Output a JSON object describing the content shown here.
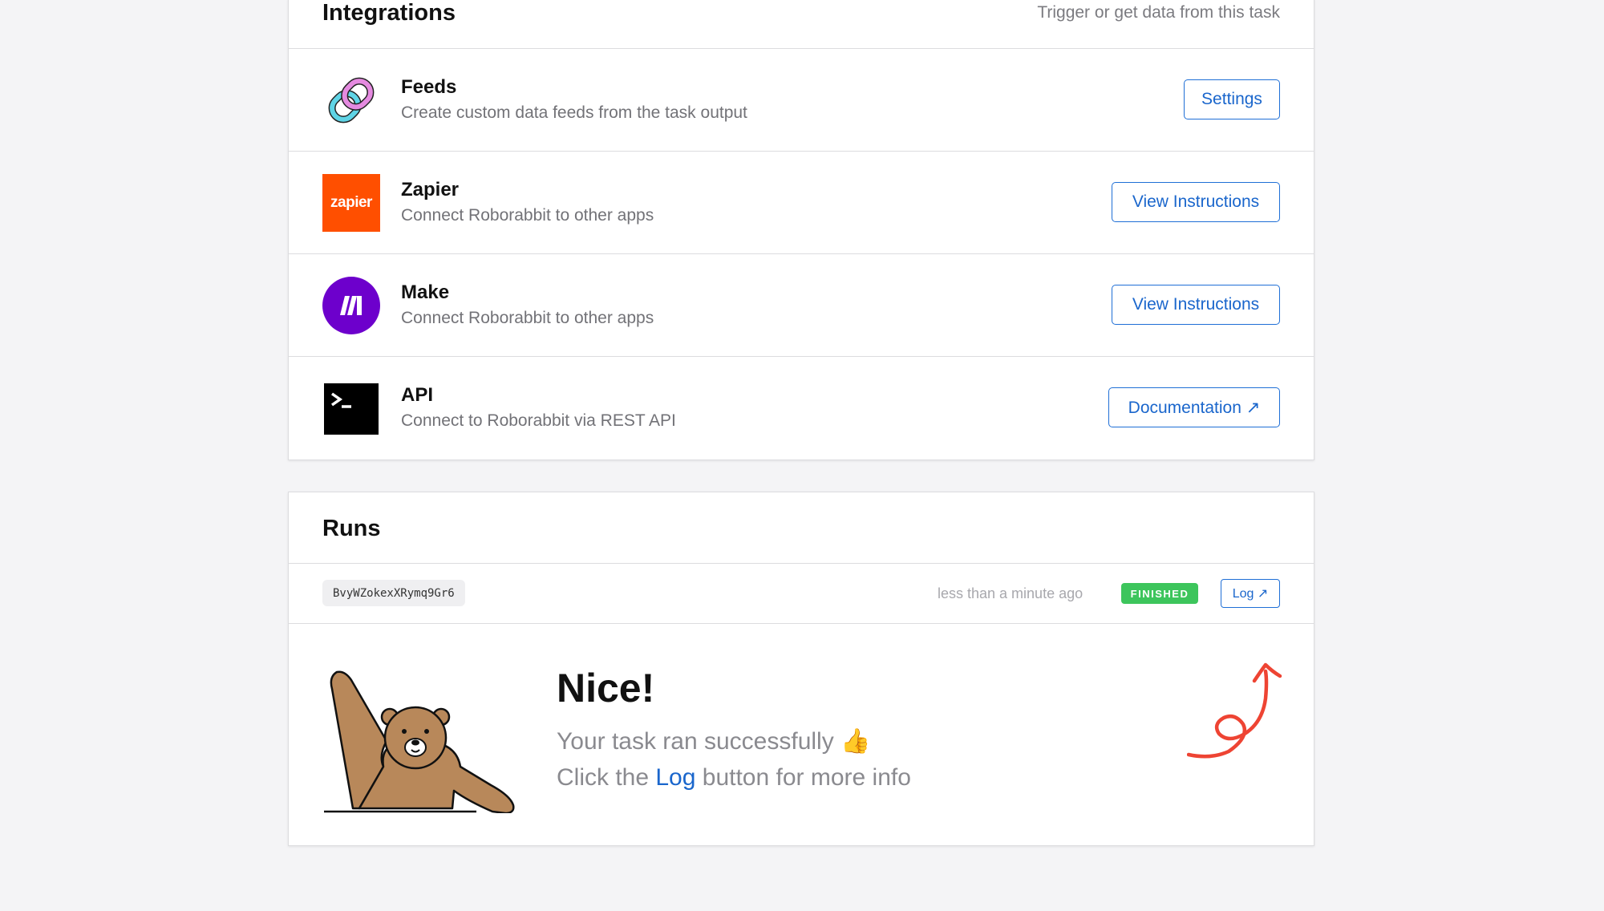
{
  "integrations": {
    "title": "Integrations",
    "subtitle": "Trigger or get data from this task",
    "rows": [
      {
        "title": "Feeds",
        "desc": "Create custom data feeds from the task output",
        "button": "Settings",
        "icon": "chain-link-icon"
      },
      {
        "title": "Zapier",
        "desc": "Connect Roborabbit to other apps",
        "button": "View Instructions",
        "icon": "zapier-logo",
        "logo_text": "zapier"
      },
      {
        "title": "Make",
        "desc": "Connect Roborabbit to other apps",
        "button": "View Instructions",
        "icon": "make-logo"
      },
      {
        "title": "API",
        "desc": "Connect to Roborabbit via REST API",
        "button": "Documentation ↗",
        "icon": "terminal-icon"
      }
    ]
  },
  "runs": {
    "title": "Runs",
    "run": {
      "id": "BvyWZokexXRymq9Gr6",
      "time": "less than a minute ago",
      "status": "FINISHED",
      "log_label": "Log ↗"
    },
    "success": {
      "title": "Nice!",
      "line1": "Your task ran successfully 👍",
      "line2_prefix": "Click the ",
      "line2_link": "Log",
      "line2_suffix": " button for more info"
    }
  },
  "colors": {
    "accent": "#1a66cc",
    "status_finished": "#3dc55c",
    "zapier": "#ff4f00",
    "make": "#6d00cc",
    "arrow": "#ee4433",
    "bear": "#b8885a"
  }
}
